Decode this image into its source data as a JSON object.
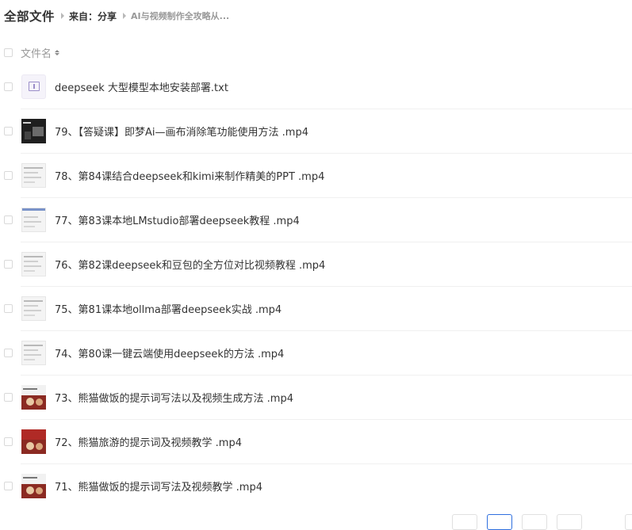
{
  "header": {
    "title": "全部文件",
    "source_label": "来自：分享",
    "folder_name": "AI与视频制作全攻略从..."
  },
  "column_header": {
    "filename_label": "文件名"
  },
  "files": [
    {
      "name": "deepseek 大型模型本地安装部署.txt",
      "thumb": "txt-file-icon"
    },
    {
      "name": "79、【答疑课】即梦Ai—画布消除笔功能使用方法 .mp4",
      "thumb": "video-thumbnail"
    },
    {
      "name": "78、第84课结合deepseek和kimi来制作精美的PPT .mp4",
      "thumb": "video-thumbnail"
    },
    {
      "name": "77、第83课本地LMstudio部署deepseek教程 .mp4",
      "thumb": "video-thumbnail"
    },
    {
      "name": "76、第82课deepseek和豆包的全方位对比视频教程 .mp4",
      "thumb": "video-thumbnail"
    },
    {
      "name": "75、第81课本地ollma部署deepseek实战 .mp4",
      "thumb": "video-thumbnail"
    },
    {
      "name": "74、第80课一键云端使用deepseek的方法 .mp4",
      "thumb": "video-thumbnail"
    },
    {
      "name": "73、熊猫做饭的提示词写法以及视频生成方法 .mp4",
      "thumb": "video-thumbnail"
    },
    {
      "name": "72、熊猫旅游的提示词及视频教学 .mp4",
      "thumb": "video-thumbnail"
    },
    {
      "name": "71、熊猫做饭的提示词写法及视频教学 .mp4",
      "thumb": "video-thumbnail"
    }
  ],
  "colors": {
    "accent": "#2f6fdf",
    "text": "#333333",
    "muted": "#999999",
    "divider": "#f0f0f0"
  }
}
